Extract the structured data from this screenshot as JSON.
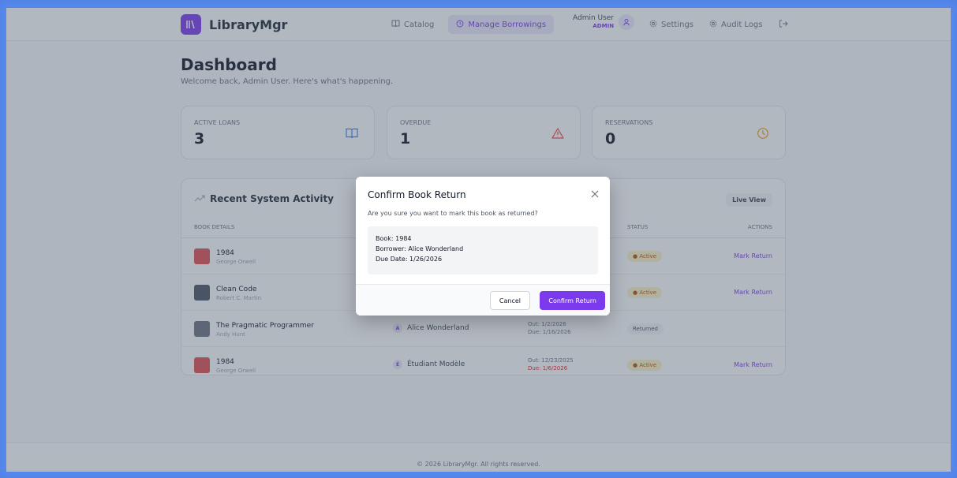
{
  "app": {
    "name": "LibraryMgr",
    "logo_icon": "library-icon"
  },
  "nav": {
    "items": [
      {
        "label": "Catalog",
        "icon": "book-icon",
        "active": false
      },
      {
        "label": "Manage Borrowings",
        "icon": "clock-icon",
        "active": true
      }
    ],
    "settings": "Settings",
    "audit_logs": "Audit Logs"
  },
  "user": {
    "name": "Admin User",
    "role": "ADMIN"
  },
  "page": {
    "title": "Dashboard",
    "subtitle": "Welcome back, Admin User. Here's what's happening."
  },
  "stats": [
    {
      "label": "ACTIVE LOANS",
      "value": "3",
      "color": "#3b82f6"
    },
    {
      "label": "OVERDUE",
      "value": "1",
      "color": "#ef4444"
    },
    {
      "label": "RESERVATIONS",
      "value": "0",
      "color": "#f59e0b"
    }
  ],
  "activity": {
    "title": "Recent System Activity",
    "live_view": "Live View",
    "columns": {
      "book": "BOOK DETAILS",
      "status": "STATUS",
      "actions": "ACTIONS"
    },
    "rows": [
      {
        "title": "1984",
        "author": "George Orwell",
        "borrower": "",
        "initial": "",
        "out": "",
        "due": "",
        "status": "Active",
        "action": "Mark Return"
      },
      {
        "title": "Clean Code",
        "author": "Robert C. Martin",
        "borrower": "",
        "initial": "",
        "out": "",
        "due": "",
        "status": "Active",
        "action": "Mark Return"
      },
      {
        "title": "The Pragmatic Programmer",
        "author": "Andy Hunt",
        "borrower": "Alice Wonderland",
        "initial": "A",
        "out": "Out: 1/2/2026",
        "due": "Due: 1/16/2026",
        "status": "Returned",
        "action": ""
      },
      {
        "title": "1984",
        "author": "George Orwell",
        "borrower": "Étudiant Modèle",
        "initial": "É",
        "out": "Out: 12/23/2025",
        "due": "Due: 1/6/2026",
        "status": "Active",
        "action": "Mark Return"
      }
    ]
  },
  "footer": "© 2026 LibraryMgr. All rights reserved.",
  "modal": {
    "title": "Confirm Book Return",
    "description": "Are you sure you want to mark this book as returned?",
    "book": "Book: 1984",
    "borrower": "Borrower: Alice Wonderland",
    "due_date": "Due Date: 1/26/2026",
    "cancel": "Cancel",
    "confirm": "Confirm Return"
  },
  "colors": {
    "accent": "#7c3aed",
    "overdue": "#dc2626"
  }
}
